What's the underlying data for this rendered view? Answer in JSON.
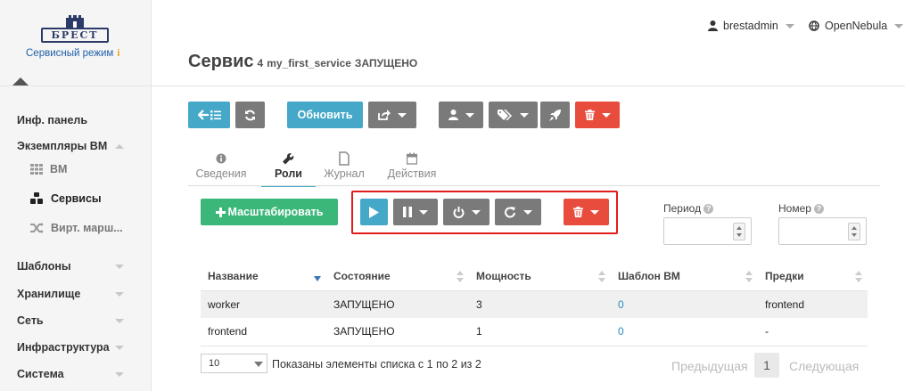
{
  "brand": {
    "logo_text": "БРЕСТ",
    "mode_label": "Сервисный режим",
    "mode_info": "i"
  },
  "sidebar": {
    "items": [
      {
        "label": "Инф. панель"
      },
      {
        "label": "Экземпляры ВМ"
      },
      {
        "label": "ВМ"
      },
      {
        "label": "Сервисы"
      },
      {
        "label": "Вирт. марш..."
      },
      {
        "label": "Шаблоны"
      },
      {
        "label": "Хранилище"
      },
      {
        "label": "Сеть"
      },
      {
        "label": "Инфраструктура"
      },
      {
        "label": "Система"
      }
    ]
  },
  "header": {
    "user": "brestadmin",
    "zone": "OpenNebula"
  },
  "page": {
    "title": "Сервис",
    "id": "4",
    "service_name": "my_first_service",
    "state": "ЗАПУЩЕНО"
  },
  "toolbar": {
    "refresh_label": "Обновить"
  },
  "tabs": [
    {
      "label": "Сведения"
    },
    {
      "label": "Роли"
    },
    {
      "label": "Журнал"
    },
    {
      "label": "Действия"
    }
  ],
  "roles_toolbar": {
    "scale_label": "Масштабировать"
  },
  "fields": {
    "period_label": "Период",
    "number_label": "Номер",
    "help": "?"
  },
  "table": {
    "headers": [
      "Название",
      "Состояние",
      "Мощность",
      "Шаблон ВМ",
      "Предки"
    ],
    "rows": [
      [
        "worker",
        "ЗАПУЩЕНО",
        "3",
        "0",
        "frontend"
      ],
      [
        "frontend",
        "ЗАПУЩЕНО",
        "1",
        "0",
        "-"
      ]
    ]
  },
  "pagination": {
    "page_size": "10",
    "info": "Показаны элементы списка с 1 по 2 из 2",
    "prev": "Предыдущая",
    "current": "1",
    "next": "Следующая"
  },
  "colors": {
    "accent": "#45a8c8",
    "danger": "#e84c3d",
    "success": "#3cb77a",
    "neutral": "#7a7a7a",
    "highlight": "#e21b1b"
  }
}
